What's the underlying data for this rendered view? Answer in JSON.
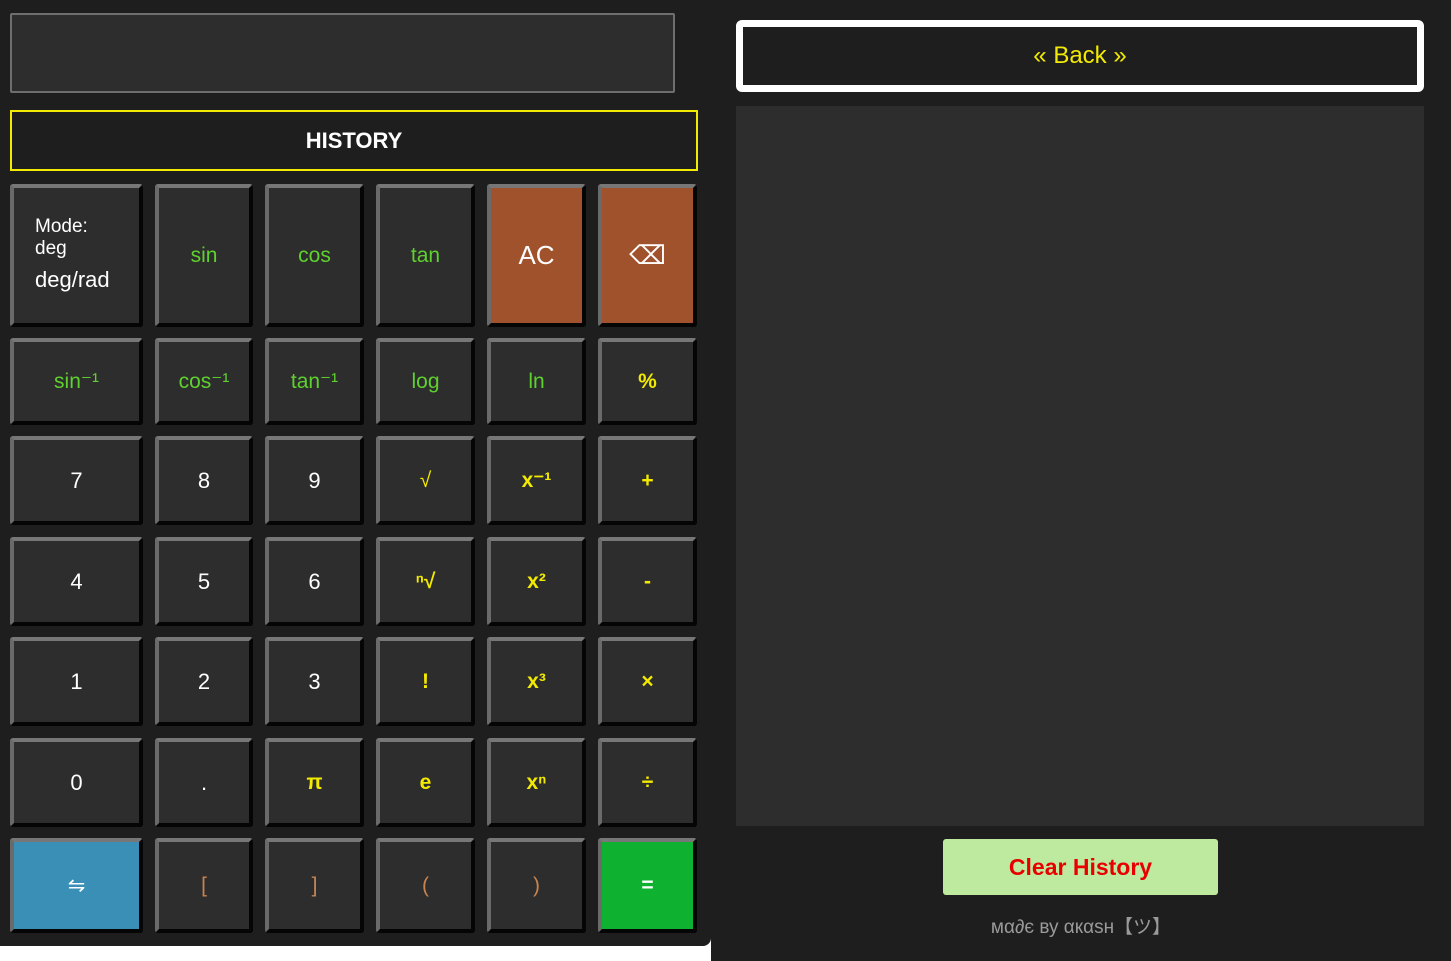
{
  "display": {
    "value": ""
  },
  "history_button": "HISTORY",
  "keys": {
    "mode_label": "Mode:",
    "mode_value": "deg",
    "mode_toggle": "deg/rad",
    "sin": "sin",
    "cos": "cos",
    "tan": "tan",
    "ac": "AC",
    "backspace": "⌫",
    "asin": "sin⁻¹",
    "acos": "cos⁻¹",
    "atan": "tan⁻¹",
    "log": "log",
    "ln": "ln",
    "percent": "%",
    "n7": "7",
    "n8": "8",
    "n9": "9",
    "sqrt": "√",
    "inverse": "x⁻¹",
    "plus": "+",
    "n4": "4",
    "n5": "5",
    "n6": "6",
    "nroot": "ⁿ√",
    "square": "x²",
    "minus": "-",
    "n1": "1",
    "n2": "2",
    "n3": "3",
    "factorial": "!",
    "cube": "x³",
    "multiply": "×",
    "n0": "0",
    "dot": ".",
    "pi": "π",
    "e": "e",
    "power": "xⁿ",
    "divide": "÷",
    "swap": "⇋",
    "lbracket": "[",
    "rbracket": "]",
    "lparen": "(",
    "rparen": ")",
    "equals": "="
  },
  "history_panel": {
    "back_label": "« Back »",
    "clear_label": "Clear History",
    "credit": "мα∂є ву αкαѕн【ツ】"
  },
  "colors": {
    "background": "#1e1e1e",
    "key": "#2d2d2d",
    "accent_yellow": "#f2ea00",
    "func_green": "#5fd12e",
    "clear_orange": "#a0522d",
    "swap_blue": "#3a8fb7",
    "equals_green": "#0fb130",
    "clear_history_bg": "#bdea9e",
    "clear_history_text": "#e80000"
  }
}
